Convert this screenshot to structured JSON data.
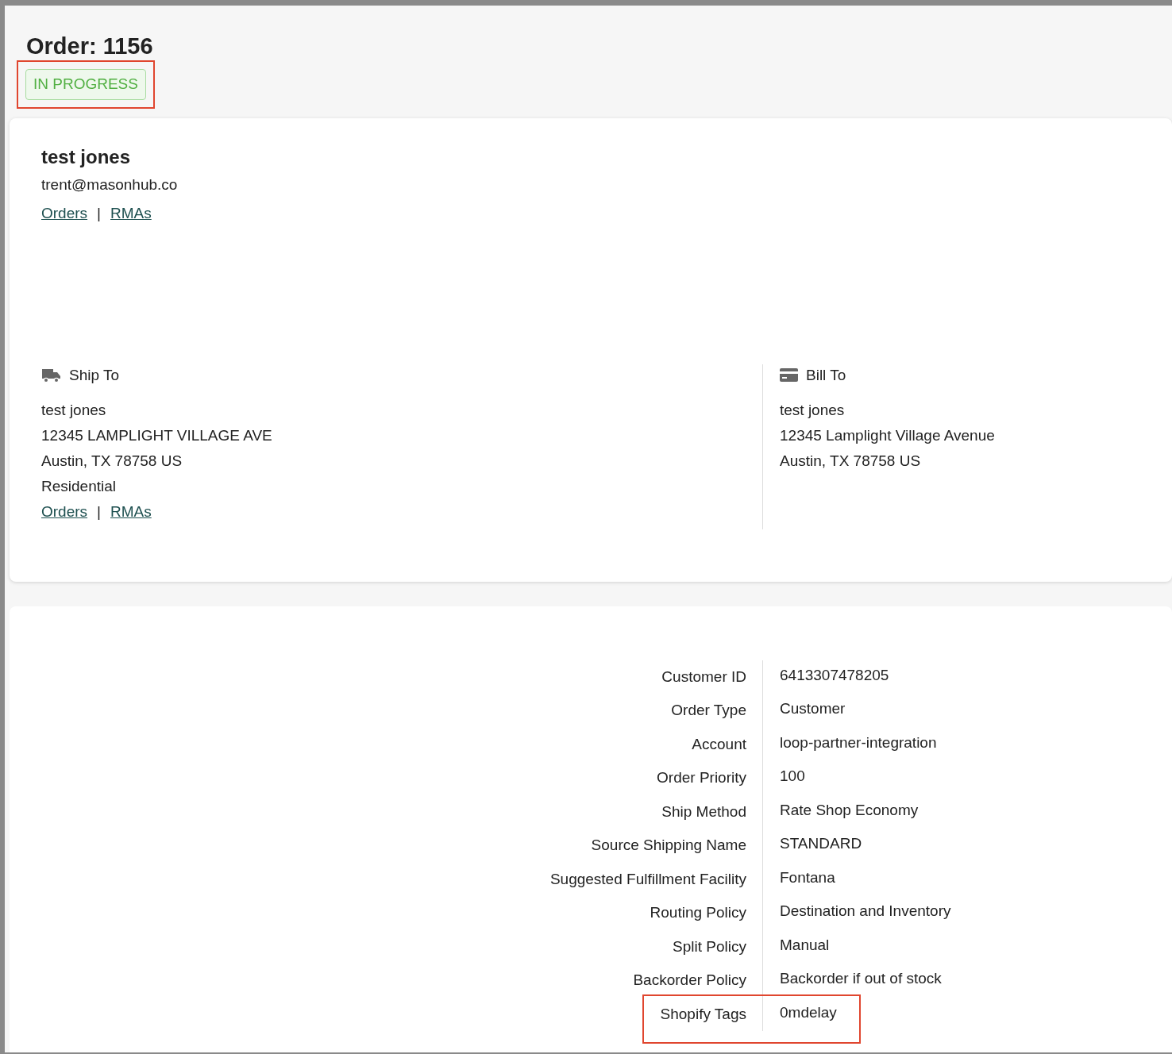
{
  "order": {
    "title": "Order: 1156",
    "status": "IN PROGRESS",
    "status_highlighted": true
  },
  "customer": {
    "name": "test jones",
    "email": "trent@masonhub.co",
    "links": [
      "Orders",
      "RMAs"
    ],
    "link_separator": "|"
  },
  "ship_to": {
    "heading": "Ship To",
    "lines": [
      "test jones",
      "12345 LAMPLIGHT VILLAGE AVE",
      "Austin, TX 78758 US",
      "Residential"
    ],
    "links": [
      "Orders",
      "RMAs"
    ],
    "link_separator": "|"
  },
  "bill_to": {
    "heading": "Bill To",
    "lines": [
      "test jones",
      "12345 Lamplight Village Avenue",
      "Austin, TX 78758 US"
    ]
  },
  "details": [
    {
      "label": "Customer ID",
      "value": "6413307478205",
      "highlighted": false
    },
    {
      "label": "Order Type",
      "value": "Customer",
      "highlighted": false
    },
    {
      "label": "Account",
      "value": "loop-partner-integration",
      "highlighted": false
    },
    {
      "label": "Order Priority",
      "value": "100",
      "highlighted": false
    },
    {
      "label": "Ship Method",
      "value": "Rate Shop Economy",
      "highlighted": false
    },
    {
      "label": "Source Shipping Name",
      "value": "STANDARD",
      "highlighted": false
    },
    {
      "label": "Suggested Fulfillment Facility",
      "value": "Fontana",
      "highlighted": false
    },
    {
      "label": "Routing Policy",
      "value": "Destination and Inventory",
      "highlighted": false
    },
    {
      "label": "Split Policy",
      "value": "Manual",
      "highlighted": false
    },
    {
      "label": "Backorder Policy",
      "value": "Backorder if out of stock",
      "highlighted": false
    },
    {
      "label": "Shopify Tags",
      "value": "0mdelay",
      "highlighted": true
    }
  ]
}
